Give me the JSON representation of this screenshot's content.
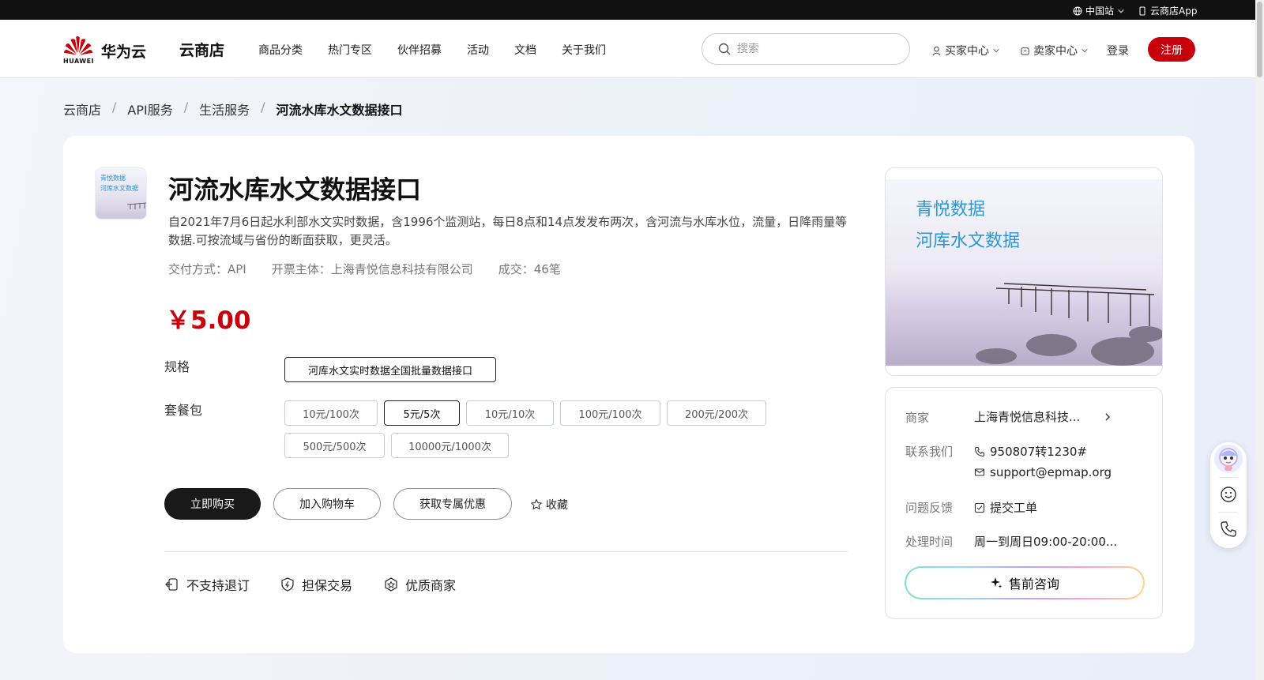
{
  "topbar": {
    "region_label": "中国站",
    "app_label": "云商店App"
  },
  "header": {
    "brand_small": "HUAWEI",
    "brand": "华为云",
    "store": "云商店",
    "nav": [
      "商品分类",
      "热门专区",
      "伙伴招募",
      "活动",
      "文档",
      "关于我们"
    ],
    "search_placeholder": "搜索",
    "buyer_center": "买家中心",
    "seller_center": "卖家中心",
    "login": "登录",
    "register": "注册",
    "brand_color": "#c7000b"
  },
  "breadcrumb": {
    "items": [
      "云商店",
      "API服务",
      "生活服务"
    ],
    "current": "河流水库水文数据接口",
    "separator": "/"
  },
  "product": {
    "thumb_text": [
      "青悦数据",
      "河库水文数据"
    ],
    "title": "河流水库水文数据接口",
    "description": "自2021年7月6日起水利部水文实时数据，含1996个监测站，每日8点和14点发发布两次，含河流与水库水位，流量，日降雨量等数据.可按流域与省份的断面获取，更灵活。",
    "delivery": "交付方式：API",
    "invoice": "开票主体：上海青悦信息科技有限公司",
    "deals": "成交：46笔",
    "price": "￥5.00"
  },
  "spec": {
    "label": "规格",
    "options": [
      "河库水文实时数据全国批量数据接口"
    ],
    "selected_index": 0
  },
  "package": {
    "label": "套餐包",
    "options": [
      "10元/100次",
      "5元/5次",
      "10元/10次",
      "100元/100次",
      "200元/200次",
      "500元/500次",
      "10000元/1000次"
    ],
    "selected_index": 1
  },
  "actions": {
    "buy": "立即购买",
    "cart": "加入购物车",
    "deal": "获取专属优惠",
    "favorite": "收藏"
  },
  "assurances": [
    "不支持退订",
    "担保交易",
    "优质商家"
  ],
  "preview": {
    "line1": "青悦数据",
    "line2": "河库水文数据"
  },
  "seller": {
    "merchant_key": "商家",
    "merchant_value": "上海青悦信息科技...",
    "contact_key": "联系我们",
    "phone": "950807转1230#",
    "email": "support@epmap.org",
    "feedback_key": "问题反馈",
    "feedback_value": "提交工单",
    "hours_key": "处理时间",
    "hours_value": "周一到周日09:00-20:00...",
    "consult": "售前咨询"
  },
  "icons": {
    "globe": "globe-icon",
    "phone_app": "mobile-icon",
    "search": "search-icon",
    "user": "user-icon",
    "store": "store-icon",
    "star": "star-icon",
    "sparkle": "sparkle-icon",
    "assistant": "assistant-avatar-icon",
    "smile": "smile-icon",
    "phone": "phone-icon"
  }
}
